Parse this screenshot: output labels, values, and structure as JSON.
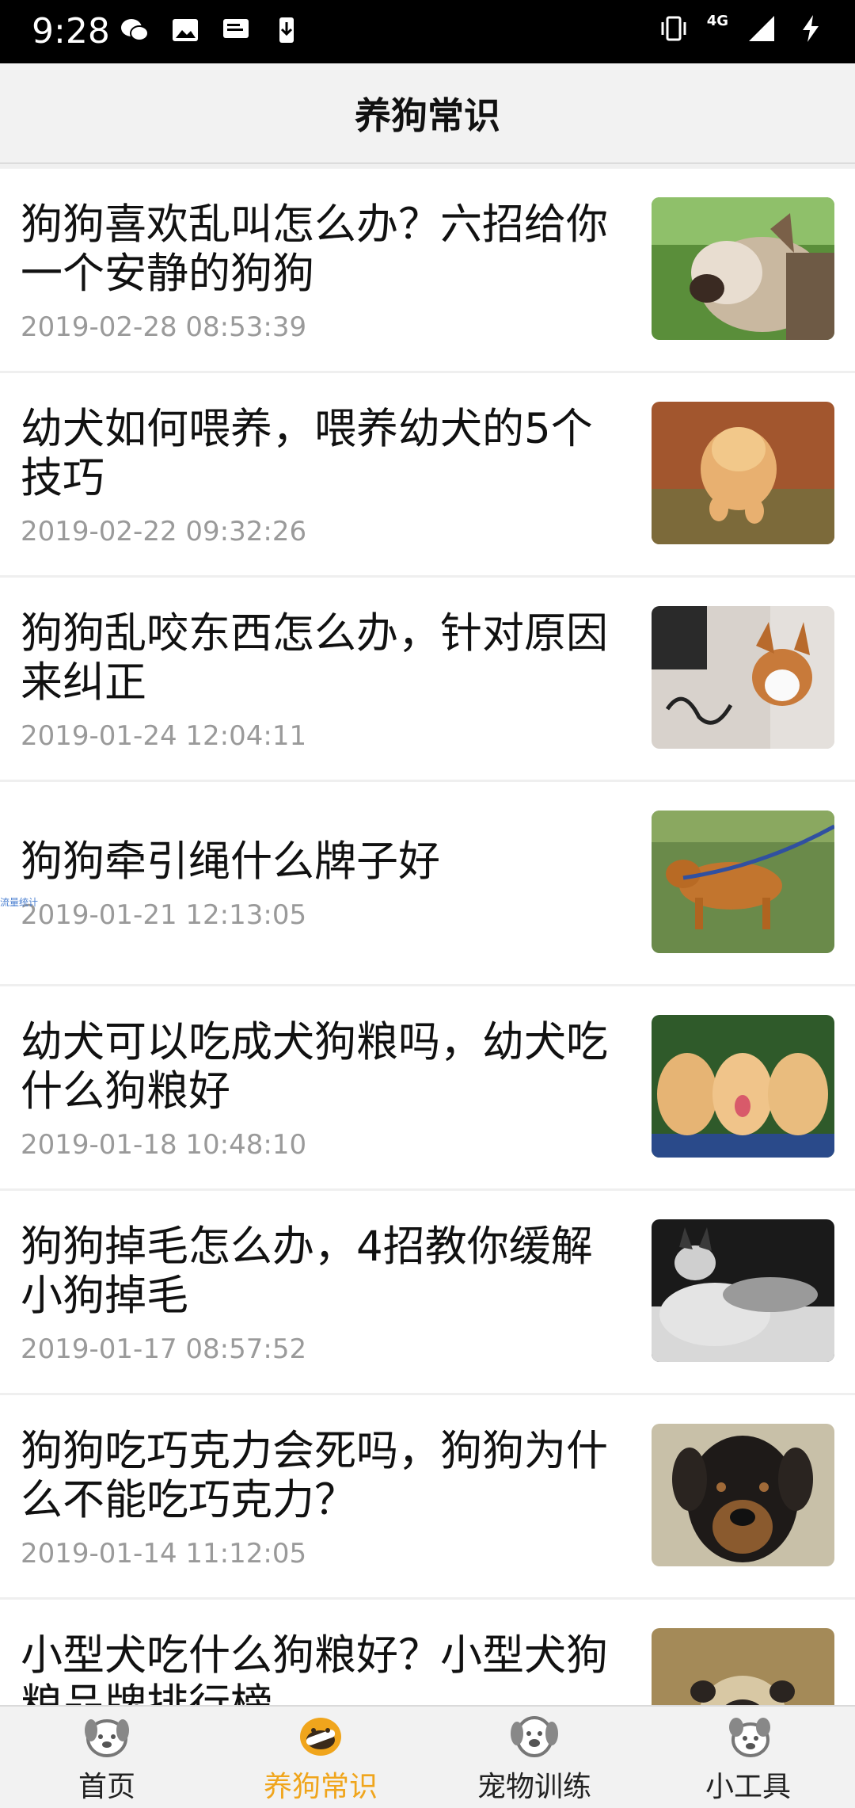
{
  "status_bar": {
    "time": "9:28",
    "network": "4G",
    "left_icons": [
      "wechat-icon",
      "image-icon",
      "message-icon",
      "download-icon"
    ],
    "right_icons": [
      "vibrate-icon",
      "signal-icon",
      "charging-icon"
    ]
  },
  "header": {
    "title": "养狗常识"
  },
  "articles": [
    {
      "title": "狗狗喜欢乱叫怎么办？六招给你一个安静的狗狗",
      "date": "2019-02-28 08:53:39",
      "image": "barking-dog"
    },
    {
      "title": "幼犬如何喂养，喂养幼犬的5个技巧",
      "date": "2019-02-22 09:32:26",
      "image": "puppy-running"
    },
    {
      "title": "狗狗乱咬东西怎么办，针对原因来纠正",
      "date": "2019-01-24 12:04:11",
      "image": "corgi-chewing"
    },
    {
      "title": "狗狗牵引绳什么牌子好",
      "date": "2019-01-21 12:13:05",
      "image": "dog-on-leash"
    },
    {
      "title": "幼犬可以吃成犬狗粮吗，幼犬吃什么狗粮好",
      "date": "2019-01-18 10:48:10",
      "image": "three-puppies"
    },
    {
      "title": "狗狗掉毛怎么办，4招教你缓解小狗掉毛",
      "date": "2019-01-17 08:57:52",
      "image": "husky-shedding"
    },
    {
      "title": "狗狗吃巧克力会死吗，狗狗为什么不能吃巧克力？",
      "date": "2019-01-14 11:12:05",
      "image": "rottweiler"
    },
    {
      "title": "小型犬吃什么狗粮好？小型犬狗粮品牌排行榜",
      "date": "",
      "image": "pug"
    }
  ],
  "side_watermark": "流量统计",
  "bottom_nav": {
    "tabs": [
      {
        "label": "首页",
        "icon": "dog-home-icon",
        "active": false
      },
      {
        "label": "养狗常识",
        "icon": "dog-bone-icon",
        "active": true
      },
      {
        "label": "宠物训练",
        "icon": "dog-training-icon",
        "active": false
      },
      {
        "label": "小工具",
        "icon": "dog-tools-icon",
        "active": false
      }
    ]
  },
  "colors": {
    "active_tab": "#f0a51c",
    "date_text": "#9a9a9a",
    "header_bg": "#f2f2f2"
  }
}
